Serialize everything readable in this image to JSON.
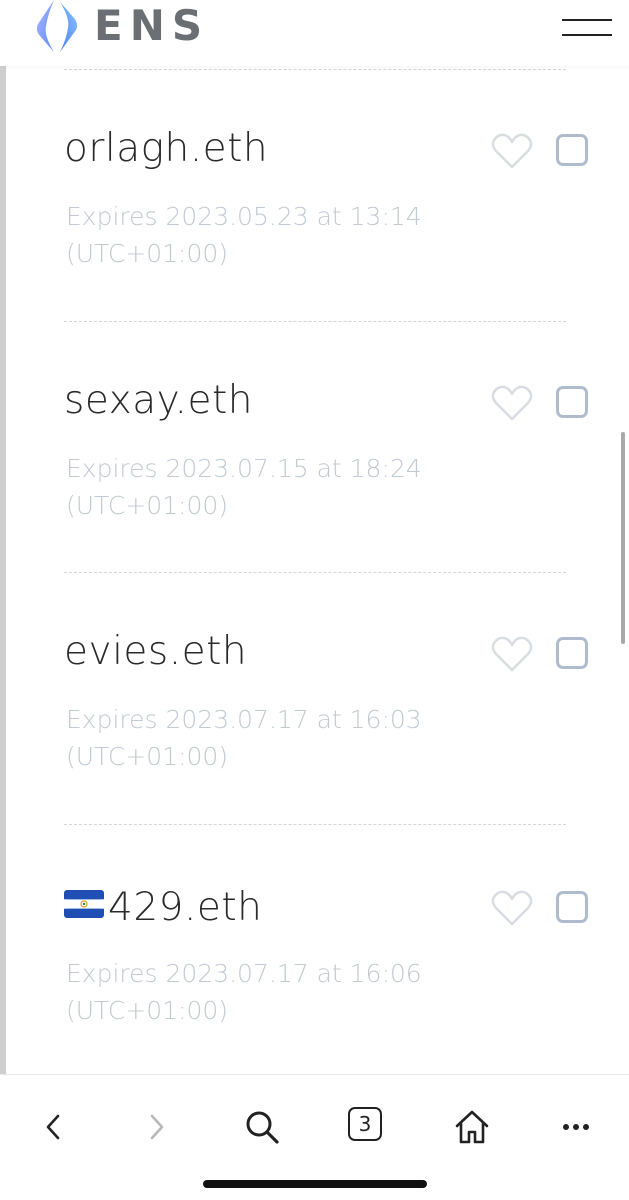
{
  "header": {
    "brand": "ENS",
    "logo_icon": "ens-logo-icon",
    "menu_icon": "hamburger-menu-icon"
  },
  "colors": {
    "brand_text": "#6b6f74",
    "name_text": "#2a2a2a",
    "expiry_text": "#c3c9d1",
    "checkbox_border": "#aebccd",
    "heart_outline": "#d9dde2"
  },
  "domains": [
    {
      "flag": "",
      "name": "orlagh.eth",
      "expires_line1": "Expires 2023.05.23 at 13:14",
      "expires_line2": "(UTC+01:00)",
      "favorite_icon": "heart-outline-icon",
      "selected": false
    },
    {
      "flag": "",
      "name": "sexay.eth",
      "expires_line1": "Expires 2023.07.15 at 18:24",
      "expires_line2": "(UTC+01:00)",
      "favorite_icon": "heart-outline-icon",
      "selected": false
    },
    {
      "flag": "",
      "name": "evies.eth",
      "expires_line1": "Expires 2023.07.17 at 16:03",
      "expires_line2": "(UTC+01:00)",
      "favorite_icon": "heart-outline-icon",
      "selected": false
    },
    {
      "flag": "el-salvador-flag-icon",
      "name": "429.eth",
      "expires_line1": "Expires 2023.07.17 at 16:06",
      "expires_line2": "(UTC+01:00)",
      "favorite_icon": "heart-outline-icon",
      "selected": false
    }
  ],
  "toolbar": {
    "back_icon": "chevron-left-icon",
    "forward_icon": "chevron-right-icon",
    "search_icon": "search-icon",
    "tab_count": "3",
    "home_icon": "home-icon",
    "more_icon": "more-dots-icon"
  }
}
